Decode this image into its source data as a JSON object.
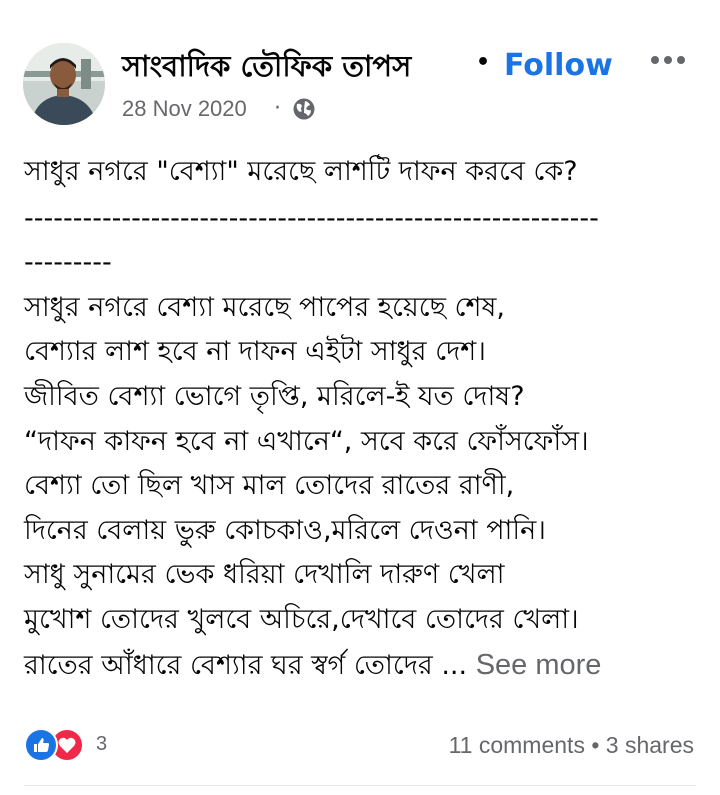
{
  "post": {
    "author": "সাংবাদিক তৌফিক তাপস",
    "separator": "•",
    "follow_label": "Follow",
    "timestamp": "28 Nov 2020",
    "privacy_separator": "·",
    "privacy_icon": "globe-icon",
    "more_icon": "more-horizontal-icon",
    "title": "সাধুর নগরে \"বেশ্যা\" মরেছে লাশটি দাফন করবে কে?",
    "dashes_1": "-----------------------------------------------------------",
    "dashes_2": "---------",
    "lines": [
      "সাধুর নগরে বেশ্যা মরেছে পাপের হয়েছে শেষ,",
      "বেশ্যার লাশ হবে না দাফন এইটা সাধুর দেশ।",
      "জীবিত বেশ্যা ভোগে তৃপ্তি, মরিলে-ই যত দোষ?",
      "“দাফন কাফন হবে না এখানে“, সবে করে ফোঁসফোঁস।",
      "বেশ্যা তো ছিল খাস মাল তোদের রাতের রাণী,",
      "দিনের বেলায় ভুরু কোচকাও,মরিলে দেওনা পানি।",
      "সাধু সুনামের ভেক ধরিয়া দেখালি দারুণ খেলা",
      "মুখোশ তোদের খুলবে অচিরে,দেখাবে তোদের খেলা।",
      "রাতের আঁধারে বেশ্যার ঘর স্বর্গ তোদের ..."
    ],
    "see_more_label": "See more"
  },
  "footer": {
    "reaction_icons": [
      "like-icon",
      "love-icon"
    ],
    "reaction_count": "3",
    "stats": "11 comments • 3 shares"
  },
  "colors": {
    "accent": "#1b74e4",
    "secondary_text": "#65676b",
    "love": "#f02849"
  }
}
